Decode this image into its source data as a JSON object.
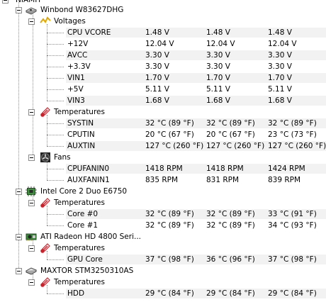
{
  "root": {
    "label": "NIAMH"
  },
  "motherboard": {
    "label": "Winbond W83627DHG",
    "voltages": {
      "label": "Voltages",
      "rows": [
        {
          "name": "CPU VCORE",
          "current": "1.48 V",
          "min": "1.48 V",
          "max": "1.48 V"
        },
        {
          "name": "+12V",
          "current": "12.04 V",
          "min": "12.04 V",
          "max": "12.04 V"
        },
        {
          "name": "AVCC",
          "current": "3.30 V",
          "min": "3.30 V",
          "max": "3.30 V"
        },
        {
          "name": "+3.3V",
          "current": "3.30 V",
          "min": "3.30 V",
          "max": "3.30 V"
        },
        {
          "name": "VIN1",
          "current": "1.70 V",
          "min": "1.70 V",
          "max": "1.70 V"
        },
        {
          "name": "+5V",
          "current": "5.11 V",
          "min": "5.11 V",
          "max": "5.11 V"
        },
        {
          "name": "VIN3",
          "current": "1.68 V",
          "min": "1.68 V",
          "max": "1.68 V"
        }
      ]
    },
    "temperatures": {
      "label": "Temperatures",
      "rows": [
        {
          "name": "SYSTIN",
          "current": "32 °C  (89 °F)",
          "min": "32 °C  (89 °F)",
          "max": "32 °C  (89 °F)"
        },
        {
          "name": "CPUTIN",
          "current": "20 °C  (67 °F)",
          "min": "20 °C  (67 °F)",
          "max": "23 °C  (73 °F)"
        },
        {
          "name": "AUXTIN",
          "current": "127 °C  (260 °F)",
          "min": "127 °C  (260 °F)",
          "max": "127 °C  (260 °F)"
        }
      ]
    },
    "fans": {
      "label": "Fans",
      "rows": [
        {
          "name": "CPUFANIN0",
          "current": "1418 RPM",
          "min": "1418 RPM",
          "max": "1424 RPM"
        },
        {
          "name": "AUXFANIN1",
          "current": "835 RPM",
          "min": "831 RPM",
          "max": "839 RPM"
        }
      ]
    }
  },
  "cpu": {
    "label": "Intel Core 2 Duo E6750",
    "temperatures": {
      "label": "Temperatures",
      "rows": [
        {
          "name": "Core #0",
          "current": "32 °C  (89 °F)",
          "min": "32 °C  (89 °F)",
          "max": "33 °C  (91 °F)"
        },
        {
          "name": "Core #1",
          "current": "32 °C  (89 °F)",
          "min": "32 °C  (89 °F)",
          "max": "34 °C  (93 °F)"
        }
      ]
    }
  },
  "gpu": {
    "label": "ATI Radeon HD 4800 Seri...",
    "temperatures": {
      "label": "Temperatures",
      "rows": [
        {
          "name": "GPU Core",
          "current": "37 °C  (98 °F)",
          "min": "36 °C  (96 °F)",
          "max": "37 °C  (98 °F)"
        }
      ]
    }
  },
  "hdd": {
    "label": "MAXTOR STM3250310AS",
    "temperatures": {
      "label": "Temperatures",
      "rows": [
        {
          "name": "HDD",
          "current": "29 °C  (84 °F)",
          "min": "29 °C  (84 °F)",
          "max": "29 °C  (84 °F)"
        }
      ]
    }
  },
  "colors": {
    "row_shade": "#f2f2f2",
    "tree_line": "#8c8c8c",
    "thermometer": "#c8232d",
    "voltage_bolt": "#e0a800"
  }
}
